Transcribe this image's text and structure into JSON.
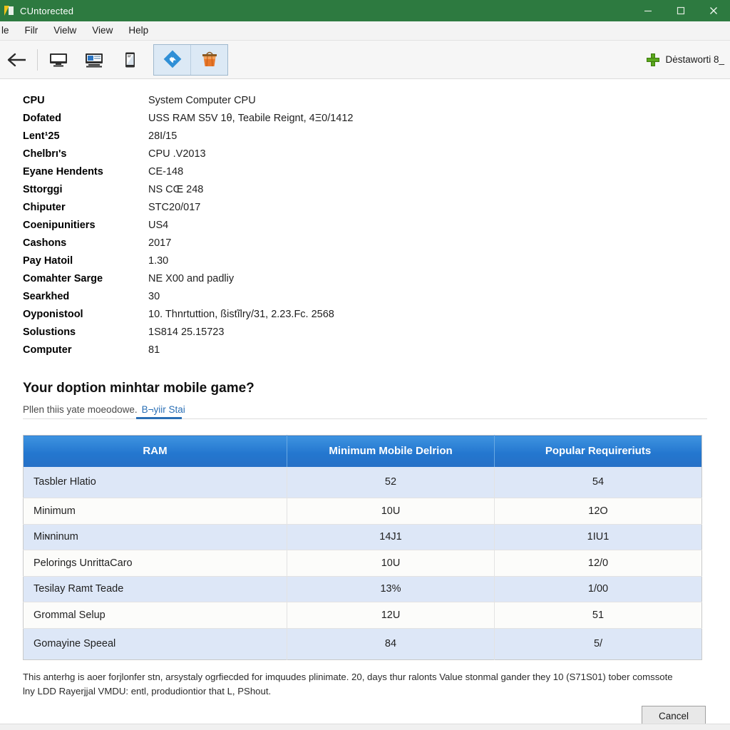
{
  "window": {
    "title": "CUntorected",
    "app_icon": "app-logo-icon",
    "controls": {
      "minimize": "minimize-icon",
      "maximize": "maximize-icon",
      "close": "close-icon"
    }
  },
  "menubar": {
    "items": [
      {
        "label": "le"
      },
      {
        "label": "Filr"
      },
      {
        "label": "Vielw"
      },
      {
        "label": "View"
      },
      {
        "label": "Help"
      }
    ]
  },
  "toolbar": {
    "back_icon": "back-arrow-icon",
    "buttons": [
      {
        "icon": "monitor-icon"
      },
      {
        "icon": "desktop-window-icon"
      },
      {
        "icon": "tablet-icon"
      }
    ],
    "group": [
      {
        "icon": "blue-diamond-icon"
      },
      {
        "icon": "orange-basket-icon"
      }
    ],
    "right": {
      "plus_icon": "plus-icon",
      "label": "Dėstaworti 8_"
    }
  },
  "specs": [
    {
      "label": "CPU",
      "value": "System Computer CPU"
    },
    {
      "label": "Dofated",
      "value": "USS RAM S5V 1θ, Teabile Reignt, 4Ξ0/1412"
    },
    {
      "label": "Lent¹25",
      "value": "28I/15"
    },
    {
      "label": "Chelbrı's",
      "value": "CPU .V2013"
    },
    {
      "label": "Eyane Hendents",
      "value": "CE-148"
    },
    {
      "label": "Sttorggi",
      "value": "NS CŒ 248"
    },
    {
      "label": "Chiputer",
      "value": "STC20/017"
    },
    {
      "label": "Coenipunitiers",
      "value": "US4"
    },
    {
      "label": "Cashons",
      "value": "2017"
    },
    {
      "label": "Pay Hatoil",
      "value": "1.30"
    },
    {
      "label": "Comahter Sarge",
      "value": "NE X00 and padliy"
    },
    {
      "label": "Searkhed",
      "value": "30"
    },
    {
      "label": "Oyponistool",
      "value": "10. Thnrtuttion, ßistĩlry/31, 2.23.Fc. 2568"
    },
    {
      "label": "Solustions",
      "value": "1S814 25.15723"
    },
    {
      "label": "Computer",
      "value": "81"
    }
  ],
  "section": {
    "heading": "Your doption minhtar mobile game?",
    "subtitle": "Pllen thiis yate moeodowe.",
    "link_label": "B¬yiir Stai"
  },
  "table": {
    "columns": [
      "RAM",
      "Minimum Mobile Delrion",
      "Popular Requireriuts"
    ],
    "rows": [
      {
        "name": "Tasbler Hlatio",
        "minimum": "52",
        "popular": "54"
      },
      {
        "name": "Minimum",
        "minimum": "10U",
        "popular": "12O"
      },
      {
        "name": "Miɴninum",
        "minimum": "14J1",
        "popular": "1IU1"
      },
      {
        "name": "Pelorings UnrittaCaro",
        "minimum": "10U",
        "popular": "12/0"
      },
      {
        "name": "Tesilay Ramt Teade",
        "minimum": "13%",
        "popular": "1/00"
      },
      {
        "name": "Grommal Selup",
        "minimum": "12U",
        "popular": "51"
      },
      {
        "name": "Gomayine Speeal",
        "minimum": "84",
        "popular": "5/"
      }
    ]
  },
  "footer": {
    "note": "This anterhg is aoer forјlonfer stn, arsystaly ogrfiecded for imquudes plinimate. 20, days thur ralontѕ Value stonmal gander they 10 (S71S01) tober comssote lny LDD Rayerјjal VMDU: entl, produdiontior that L, PShout.",
    "cancel_label": "Cancel"
  },
  "colors": {
    "titlebar_green": "#2d7a40",
    "table_header_blue": "#2477cf",
    "row_alt_blue": "#dde7f7",
    "link_blue": "#2a6fb5",
    "plus_green": "#5aa81c"
  }
}
